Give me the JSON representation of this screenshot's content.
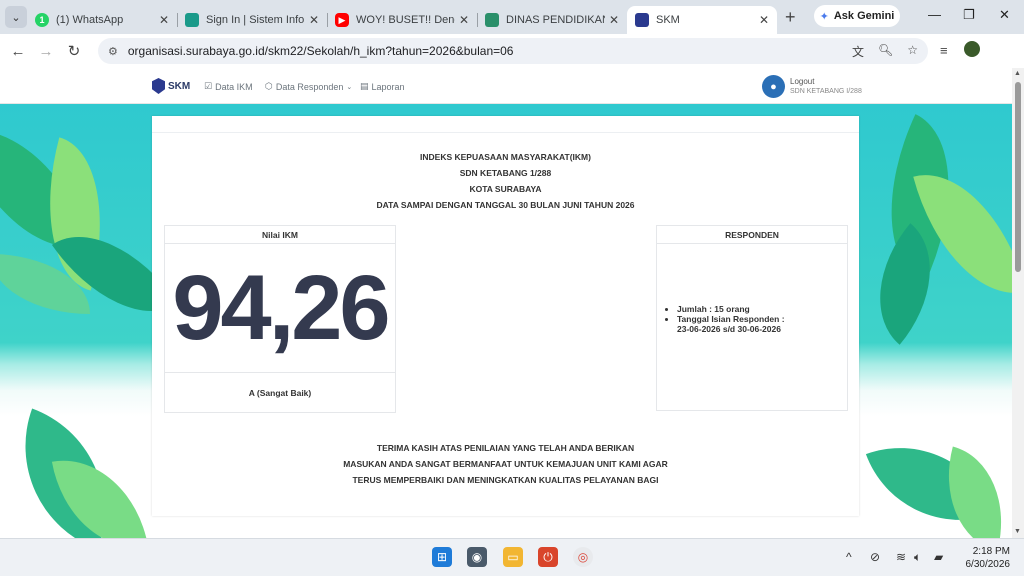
{
  "browser": {
    "tabs": [
      {
        "title": "(1) WhatsApp",
        "favicon": "whatsapp-icon",
        "color": "#25d366",
        "badge": "1"
      },
      {
        "title": "Sign In | Sistem Info",
        "favicon": "sistem-info-icon",
        "color": "#1a9a8a",
        "badge": ""
      },
      {
        "title": "WOY! BUSET!! Deng",
        "favicon": "youtube-icon",
        "color": "#ff0000",
        "badge": ""
      },
      {
        "title": "DINAS PENDIDIKAN",
        "favicon": "dinas-icon",
        "color": "#2a8f6a",
        "badge": ""
      },
      {
        "title": "SKM",
        "favicon": "skm-icon",
        "color": "#2b3a8f",
        "badge": "",
        "active": true
      }
    ],
    "gemini_label": "Ask Gemini",
    "url": "organisasi.surabaya.go.id/skm22/Sekolah/h_ikm?tahun=2026&bulan=06"
  },
  "navbar": {
    "brand": "SKM",
    "menu": [
      "Data IKM",
      "Data Responden",
      "Laporan"
    ],
    "user": {
      "action": "Logout",
      "school": "SDN KETABANG I/288"
    }
  },
  "card": {
    "heading": [
      "INDEKS KEPUASAAN MASYARAKAT(IKM)",
      "SDN KETABANG 1/288",
      "KOTA SURABAYA",
      "DATA SAMPAI DENGAN TANGGAL 30 BULAN JUNI TAHUN 2026"
    ],
    "ikm": {
      "label": "Nilai IKM",
      "value": "94,26",
      "grade": "A (Sangat Baik)"
    },
    "responden": {
      "label": "RESPONDEN",
      "jumlah": "Jumlah : 15 orang",
      "tanggal_label": "Tanggal Isian Responden :",
      "tanggal_value": "23-06-2026 s/d 30-06-2026"
    },
    "footer": [
      "TERIMA KASIH ATAS PENILAIAN YANG TELAH ANDA BERIKAN",
      "MASUKAN ANDA SANGAT BERMANFAAT UNTUK KEMAJUAN UNIT KAMI AGAR",
      "TERUS MEMPERBAIKI DAN MENINGKATKAN KUALITAS PELAYANAN BAGI"
    ]
  },
  "taskbar": {
    "time": "2:18 PM",
    "date": "6/30/2026"
  }
}
